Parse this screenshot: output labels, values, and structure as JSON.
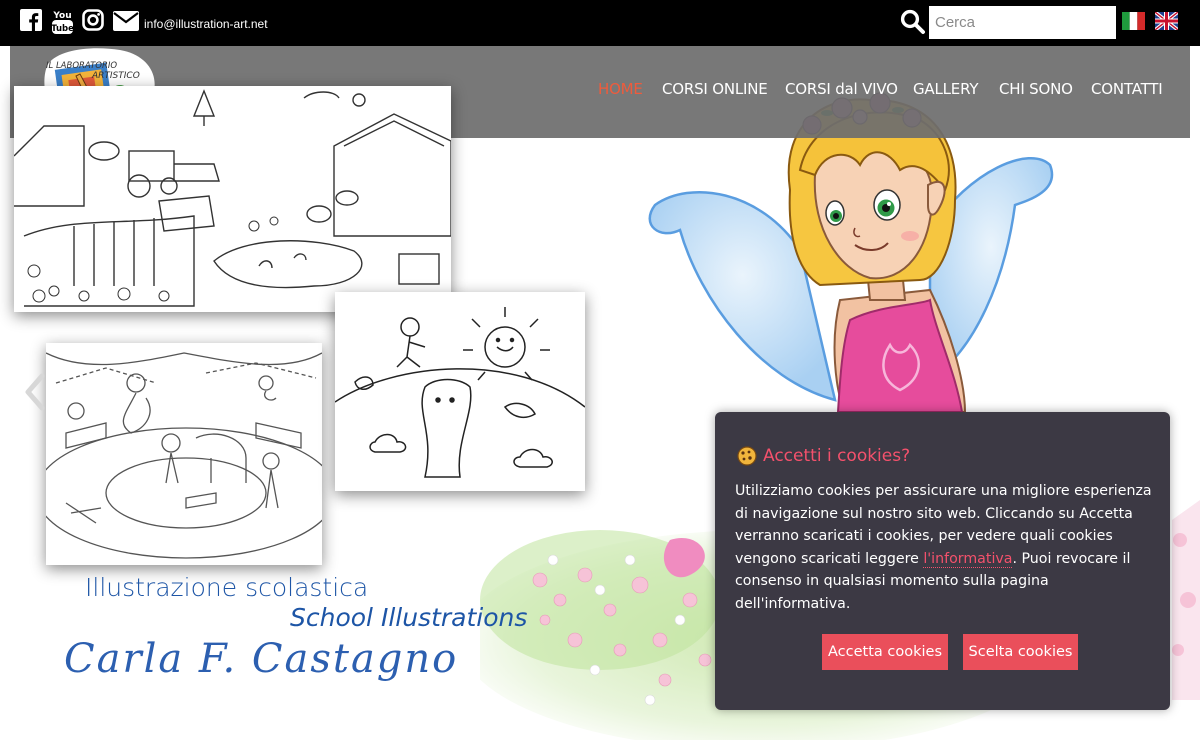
{
  "topbar": {
    "email": "info@illustration-art.net",
    "search_placeholder": "Cerca",
    "icons": [
      "facebook-icon",
      "youtube-icon",
      "instagram-icon",
      "envelope-icon",
      "search-icon"
    ],
    "flags": [
      "flag-italy",
      "flag-uk"
    ]
  },
  "logo": {
    "line1": "IL LABORATORIO",
    "line2": "ARTISTICO"
  },
  "nav": {
    "items": [
      {
        "label": "HOME",
        "active": true
      },
      {
        "label": "CORSI ONLINE",
        "active": false
      },
      {
        "label": "CORSI dal VIVO",
        "active": false
      },
      {
        "label": "GALLERY",
        "active": false
      },
      {
        "label": "CHI SONO",
        "active": false
      },
      {
        "label": "CONTATTI",
        "active": false
      }
    ],
    "active_color": "#ef5b3c"
  },
  "hero": {
    "caption_it": "Illustrazione scolastica",
    "caption_en": "School Illustrations",
    "signature": "Carla F. Castagno"
  },
  "cookie": {
    "title": "Accetti i cookies?",
    "body_before_link": "Utilizziamo cookies per assicurare una migliore esperienza di navigazione sul nostro sito web. Cliccando su Accetta verranno scaricati i cookies, per vedere quali cookies vengono scaricati leggere ",
    "link_text": "l'informativa",
    "body_after_link": ". Puoi revocare il consenso in qualsiasi momento sulla pagina dell'informativa.",
    "accept_label": "Accetta cookies",
    "choose_label": "Scelta cookies",
    "accent_color": "#f4516c"
  }
}
